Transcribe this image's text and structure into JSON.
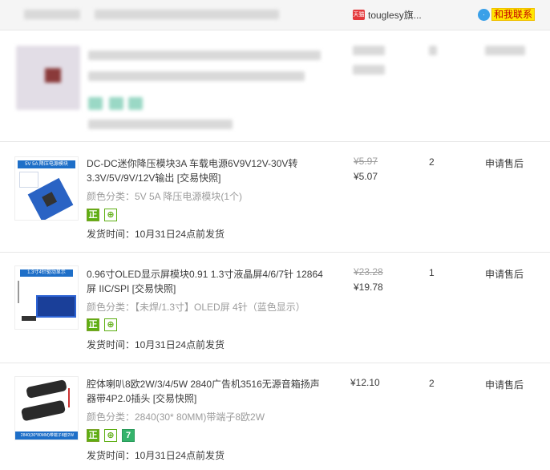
{
  "shop": {
    "name": "touglesy旗...",
    "platform_badge": "天猫",
    "contact_label": "和我联系",
    "contact_icon": "wangwang-icon"
  },
  "items": [
    {
      "title": "DC-DC迷你降压模块3A 车载电源6V9V12V-30V转3.3V/5V/9V/12V输出 [交易快照]",
      "sku": "颜色分类：5V 5A 降压电源模块(1个)",
      "ship": "发货时间：10月31日24点前发货",
      "old_price": "¥5.97",
      "price": "¥5.07",
      "qty": "2",
      "after_sale": "申请售后",
      "tags": [
        "正",
        "⊕"
      ]
    },
    {
      "title": "0.96寸OLED显示屏模块0.91 1.3寸液晶屏4/6/7针 12864屏 IIC/SPI [交易快照]",
      "sku": "颜色分类：【未焊/1.3寸】OLED屏 4针（蓝色显示）",
      "ship": "发货时间：10月31日24点前发货",
      "old_price": "¥23.28",
      "price": "¥19.78",
      "qty": "1",
      "after_sale": "申请售后",
      "tags": [
        "正",
        "⊕"
      ]
    },
    {
      "title": "腔体喇叭8欧2W/3/4/5W 2840广告机3516无源音箱扬声器带4P2.0插头 [交易快照]",
      "sku": "颜色分类：2840(30* 80MM)带端子8欧2W",
      "ship": "发货时间：10月31日24点前发货",
      "old_price": "",
      "price": "¥12.10",
      "qty": "2",
      "after_sale": "申请售后",
      "tags": [
        "正",
        "⊕",
        "7"
      ]
    }
  ],
  "thumb_texts": {
    "item1": "5V 5A 降压电源模块",
    "item2": "1.3寸4针驱动显示",
    "item3": "2840(30*80MM)带端子8欧2W"
  },
  "colors": {
    "price_strike": "#9c9c9c",
    "tag_green": "#5dae12",
    "contact_bg": "#ffe600"
  }
}
